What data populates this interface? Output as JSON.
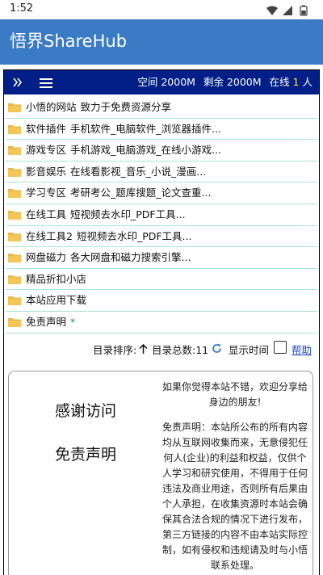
{
  "status_bar": {
    "time": "1:52",
    "icons": [
      "wifi-icon",
      "signal-icon",
      "battery-icon"
    ]
  },
  "app_bar": {
    "title": "悟界ShareHub",
    "color": "#3b7ac4"
  },
  "toolbar": {
    "color": "#011f86",
    "space_label": "空间",
    "space_value": "2000M",
    "remain_label": "剩余",
    "remain_value": "2000M",
    "online_label": "在线",
    "online_count": "1",
    "online_unit": "人"
  },
  "folders": [
    {
      "name": "小悟的网站",
      "desc": "致力于免费资源分享"
    },
    {
      "name": "软件插件",
      "desc": "手机软件_电脑软件_浏览器插件..."
    },
    {
      "name": "游戏专区",
      "desc": "手机游戏_电脑游戏_在线小游戏..."
    },
    {
      "name": "影音娱乐",
      "desc": "在线看影视_音乐_小说_漫画..."
    },
    {
      "name": "学习专区",
      "desc": "考研考公_题库搜题_论文查重..."
    },
    {
      "name": "在线工具",
      "desc": "短视频去水印_PDF工具..."
    },
    {
      "name": "在线工具2",
      "desc": "短视频去水印_PDF工具..."
    },
    {
      "name": "网盘磁力",
      "desc": "各大网盘和磁力搜索引擎..."
    },
    {
      "name": "精品折扣小店",
      "desc": ""
    },
    {
      "name": "本站应用下载",
      "desc": ""
    },
    {
      "name": "免责声明",
      "desc": "",
      "mark": "*"
    }
  ],
  "sortbar": {
    "sort_label": "目录排序:",
    "count_label": "目录总数:11",
    "show_time_label": "显示时间",
    "help_label": "帮助"
  },
  "card": {
    "heading_thanks": "感谢访问",
    "heading_disclaimer": "免责声明",
    "share_text": "如果你觉得本站不错，欢迎分享给身边的朋友!",
    "disclaimer_text": "免责声明：本站所公布的所有内容均从互联网收集而来，无意侵犯任何人(企业)的利益和权益，仅供个人学习和研究使用，不得用于任何违法及商业用途，否则所有后果由个人承担，在收集资源时本站会确保其合法合规的情况下进行发布，第三方链接的内容不由本站实际控制，如有侵权和违规请及时与小悟联系处理。"
  }
}
